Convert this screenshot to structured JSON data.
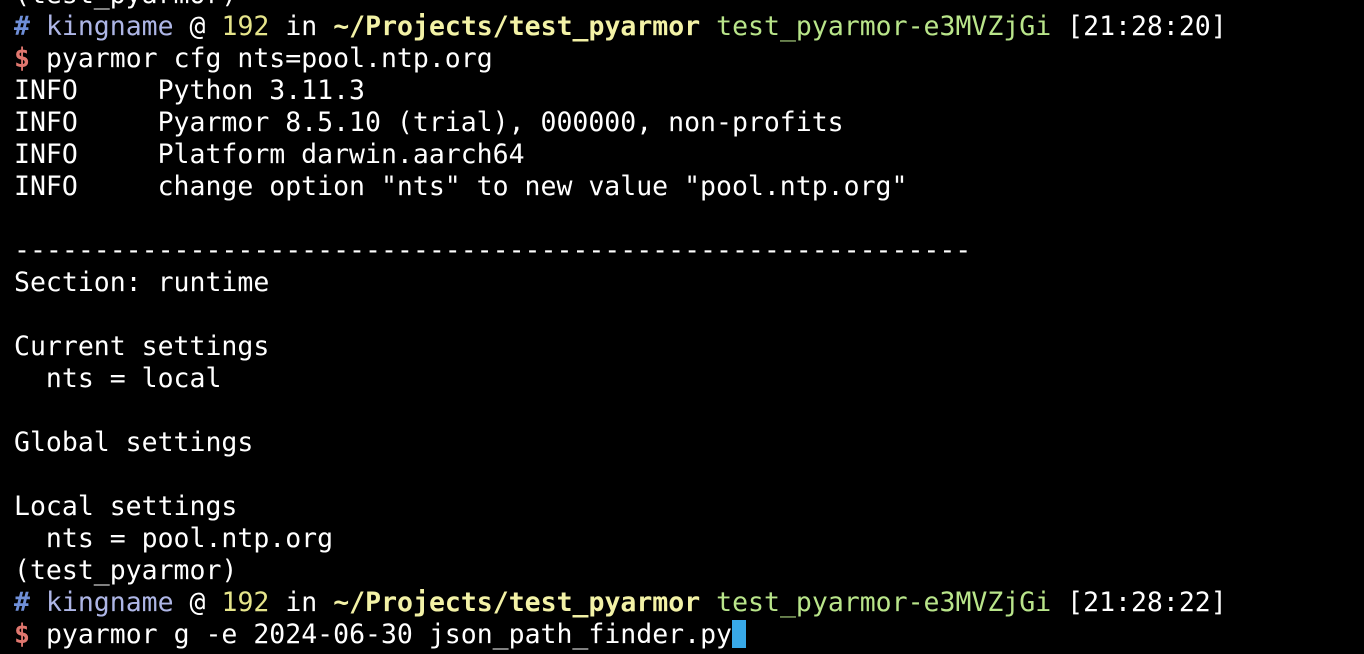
{
  "window": {
    "title": ""
  },
  "lines": [
    {
      "kind": "text",
      "text": "(test_pyarmor)"
    },
    {
      "kind": "prompt",
      "hash": "#",
      "user": "kingname",
      "at": "@",
      "host": "192",
      "in": "in",
      "path": "~/Projects/test_pyarmor",
      "env": "test_pyarmor-e3MVZjGi",
      "time": "[21:28:20]"
    },
    {
      "kind": "command",
      "dollar": "$",
      "cmd": "pyarmor cfg nts=pool.ntp.org"
    },
    {
      "kind": "text",
      "text": "INFO     Python 3.11.3"
    },
    {
      "kind": "text",
      "text": "INFO     Pyarmor 8.5.10 (trial), 000000, non-profits"
    },
    {
      "kind": "text",
      "text": "INFO     Platform darwin.aarch64"
    },
    {
      "kind": "text",
      "text": "INFO     change option \"nts\" to new value \"pool.ntp.org\""
    },
    {
      "kind": "text",
      "text": ""
    },
    {
      "kind": "text",
      "text": "------------------------------------------------------------"
    },
    {
      "kind": "text",
      "text": "Section: runtime"
    },
    {
      "kind": "text",
      "text": ""
    },
    {
      "kind": "text",
      "text": "Current settings"
    },
    {
      "kind": "text",
      "text": "  nts = local"
    },
    {
      "kind": "text",
      "text": ""
    },
    {
      "kind": "text",
      "text": "Global settings"
    },
    {
      "kind": "text",
      "text": ""
    },
    {
      "kind": "text",
      "text": "Local settings"
    },
    {
      "kind": "text",
      "text": "  nts = pool.ntp.org"
    },
    {
      "kind": "text",
      "text": "(test_pyarmor)"
    },
    {
      "kind": "prompt",
      "hash": "#",
      "user": "kingname",
      "at": "@",
      "host": "192",
      "in": "in",
      "path": "~/Projects/test_pyarmor",
      "env": "test_pyarmor-e3MVZjGi",
      "time": "[21:28:22]"
    },
    {
      "kind": "input",
      "dollar": "$",
      "cmd": "pyarmor g -e 2024-06-30 json_path_finder.py"
    }
  ],
  "colors": {
    "background": "#000000",
    "foreground": "#ffffff",
    "hash": "#6f8fd8",
    "user": "#aeb6e6",
    "host": "#e6e58b",
    "path": "#f3f2a6",
    "env": "#b9e58a",
    "dollar": "#e0776f",
    "cursor": "#38a9e8"
  },
  "icons": {
    "cursor": "block-cursor-icon"
  }
}
